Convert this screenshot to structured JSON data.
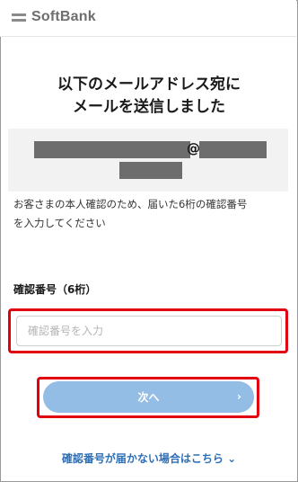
{
  "brand": {
    "name": "SoftBank",
    "icon": "softbank-bars-logo"
  },
  "title": {
    "line1": "以下のメールアドレス宛に",
    "line2": "メールを送信しました"
  },
  "email": {
    "at": "@"
  },
  "description": {
    "line1": "お客さまの本人確認のため、届いた6桁の確認番号",
    "line2": "を入力してください"
  },
  "form": {
    "label": "確認番号（6桁）",
    "placeholder": "確認番号を入力",
    "value": ""
  },
  "next_button": {
    "label": "次へ",
    "chevron": "›"
  },
  "help_link": {
    "label": "確認番号が届かない場合はこちら",
    "chevron": "⌄"
  },
  "colors": {
    "accent_link": "#2e6fb6",
    "button_disabled": "#93bde4",
    "highlight_red": "#e0000f",
    "mask_gray": "#6d6d6d"
  }
}
